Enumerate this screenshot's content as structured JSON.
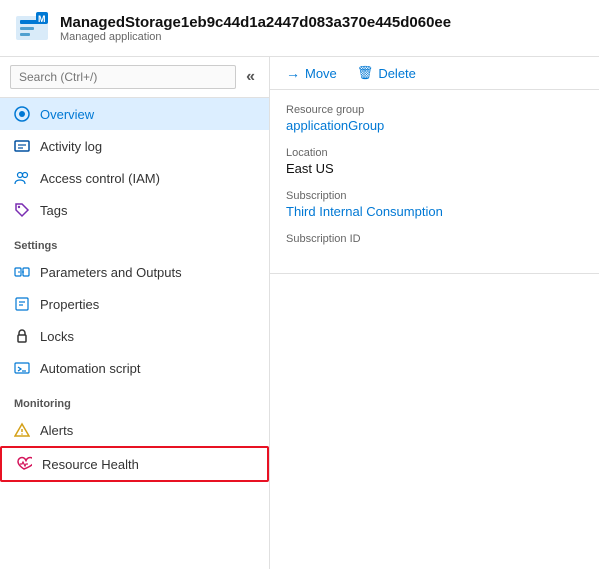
{
  "header": {
    "title": "ManagedStorage1eb9c44d1a2447d083a370e445d060ee",
    "subtitle": "Managed application"
  },
  "search": {
    "placeholder": "Search (Ctrl+/)"
  },
  "collapse_label": "«",
  "nav": {
    "items": [
      {
        "id": "overview",
        "label": "Overview",
        "active": true
      },
      {
        "id": "activity-log",
        "label": "Activity log",
        "active": false
      },
      {
        "id": "access-control",
        "label": "Access control (IAM)",
        "active": false
      },
      {
        "id": "tags",
        "label": "Tags",
        "active": false
      }
    ],
    "sections": [
      {
        "id": "settings",
        "label": "Settings",
        "items": [
          {
            "id": "parameters-outputs",
            "label": "Parameters and Outputs"
          },
          {
            "id": "properties",
            "label": "Properties"
          },
          {
            "id": "locks",
            "label": "Locks"
          },
          {
            "id": "automation-script",
            "label": "Automation script"
          }
        ]
      },
      {
        "id": "monitoring",
        "label": "Monitoring",
        "items": [
          {
            "id": "alerts",
            "label": "Alerts"
          },
          {
            "id": "resource-health",
            "label": "Resource Health",
            "highlighted": true
          }
        ]
      }
    ]
  },
  "toolbar": {
    "move_label": "Move",
    "delete_label": "Delete"
  },
  "details": {
    "resource_group_label": "Resource group",
    "resource_group_value": "applicationGroup",
    "location_label": "Location",
    "location_value": "East US",
    "subscription_label": "Subscription",
    "subscription_value": "Third Internal Consumption",
    "subscription_id_label": "Subscription ID",
    "subscription_id_value": ""
  }
}
